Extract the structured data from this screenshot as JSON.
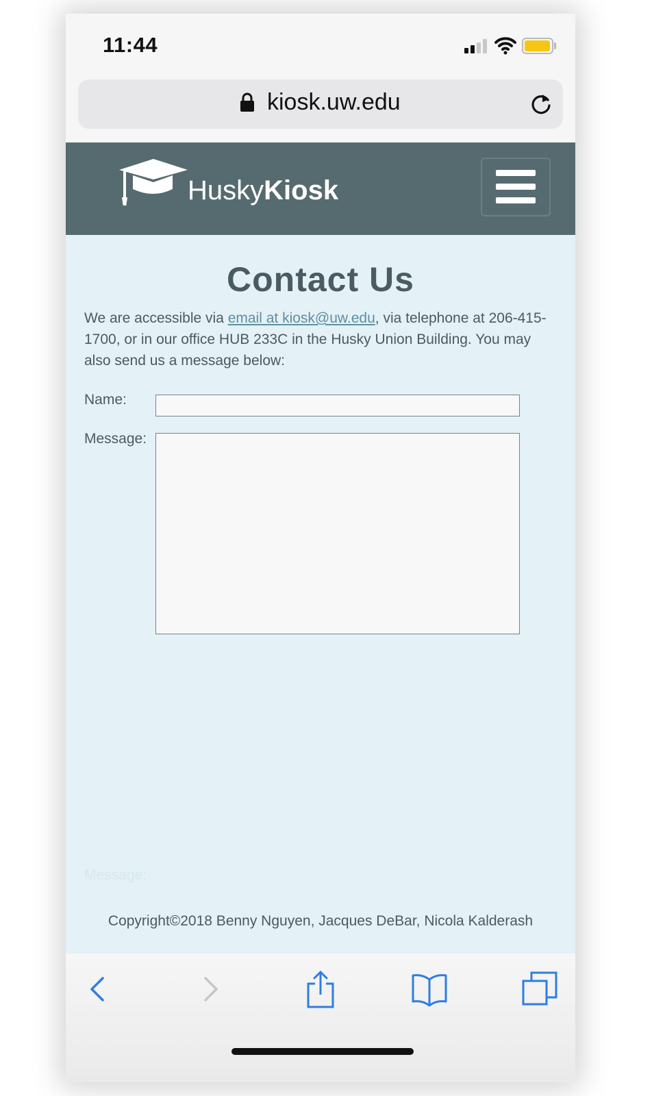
{
  "status_bar": {
    "time": "11:44"
  },
  "url_bar": {
    "url": "kiosk.uw.edu"
  },
  "header": {
    "logo_light": "Husky",
    "logo_bold": "Kiosk"
  },
  "main": {
    "title": "Contact Us",
    "intro_before": "We are accessible via ",
    "email_link": "email at kiosk@uw.edu",
    "intro_after": ", via telephone at 206-415-1700, or in our office HUB 233C in the Husky Union Building. You may also send us a message below:",
    "name_label": "Name:",
    "message_label": "Message:",
    "ghost_label": "Message:"
  },
  "footer": {
    "copyright": "Copyright©2018 Benny Nguyen, Jacques DeBar, Nicola Kalderash"
  },
  "colors": {
    "header_bg": "#566b6f",
    "content_bg": "#e4f1f6",
    "text": "#4a5b62",
    "link": "#5d8fa2",
    "toolbar_icon": "#2f7de1"
  },
  "icons": [
    "lock-icon",
    "reload-icon",
    "graduation-cap-icon",
    "menu-icon",
    "back-icon",
    "forward-icon",
    "share-icon",
    "bookmarks-icon",
    "tabs-icon"
  ]
}
